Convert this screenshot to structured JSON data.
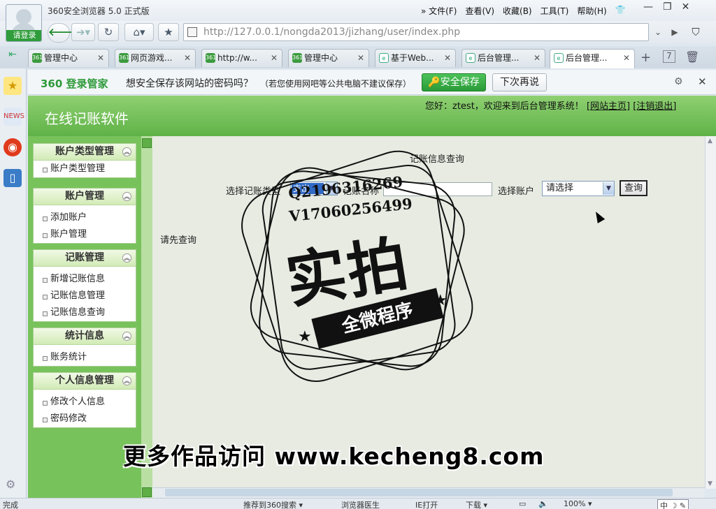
{
  "browser": {
    "title": "360安全浏览器 5.0 正式版",
    "login_label": "请登录",
    "menus": [
      "» 文件(F)",
      "查看(V)",
      "收藏(B)",
      "工具(T)",
      "帮助(H)"
    ],
    "url": "http://127.0.0.1/nongda2013/jizhang/user/index.php",
    "tabs": [
      {
        "label": "管理中心",
        "icon": "360-favicon"
      },
      {
        "label": "网页游戏...",
        "icon": "360-favicon"
      },
      {
        "label": "http://w...",
        "icon": "360-favicon"
      },
      {
        "label": "管理中心",
        "icon": "360-favicon"
      },
      {
        "label": "基于Web...",
        "icon": "ie-favicon"
      },
      {
        "label": "后台管理...",
        "icon": "ie-favicon"
      },
      {
        "label": "后台管理...",
        "icon": "ie-favicon"
      }
    ],
    "tab_count": "7",
    "status_text": "完成",
    "status_items": [
      "推荐到360搜索 ▾",
      "浏览器医生",
      "IE打开",
      "下载 ▾",
      "100% ▾",
      "中"
    ]
  },
  "password_bar": {
    "logo": "360 登录管家",
    "message": "想安全保存该网站的密码吗？",
    "note": "（若您使用网吧等公共电脑不建议保存）",
    "save_label": "安全保存",
    "later_label": "下次再说"
  },
  "site": {
    "title": "在线记账软件",
    "greeting": "您好：ztest，欢迎来到后台管理系统！",
    "home_link": "[网站主页]",
    "logout_link": "[注销退出]"
  },
  "menu": [
    {
      "title": "账户类型管理",
      "items": [
        "账户类型管理"
      ]
    },
    {
      "title": "账户管理",
      "items": [
        "添加账户",
        "账户管理"
      ]
    },
    {
      "title": "记账管理",
      "items": [
        "新增记账信息",
        "记账信息管理",
        "记账信息查询"
      ]
    },
    {
      "title": "统计信息",
      "items": [
        "账务统计"
      ]
    },
    {
      "title": "个人信息管理",
      "items": [
        "修改个人信息",
        "密码修改"
      ]
    }
  ],
  "query": {
    "title": "记账信息查询",
    "type_label": "选择记账类型",
    "type_value": "支出",
    "name_label": "记账名称",
    "name_value": "",
    "account_label": "选择账户",
    "account_value": "请选择",
    "button": "查询",
    "empty_message": "请先查询"
  },
  "overlay": {
    "qq": "Q2196316269",
    "wechat": "V17060256499",
    "stamp_main": "实拍",
    "stamp_ribbon": "全微程序",
    "caption": "更多作品访问 www.kecheng8.com"
  }
}
